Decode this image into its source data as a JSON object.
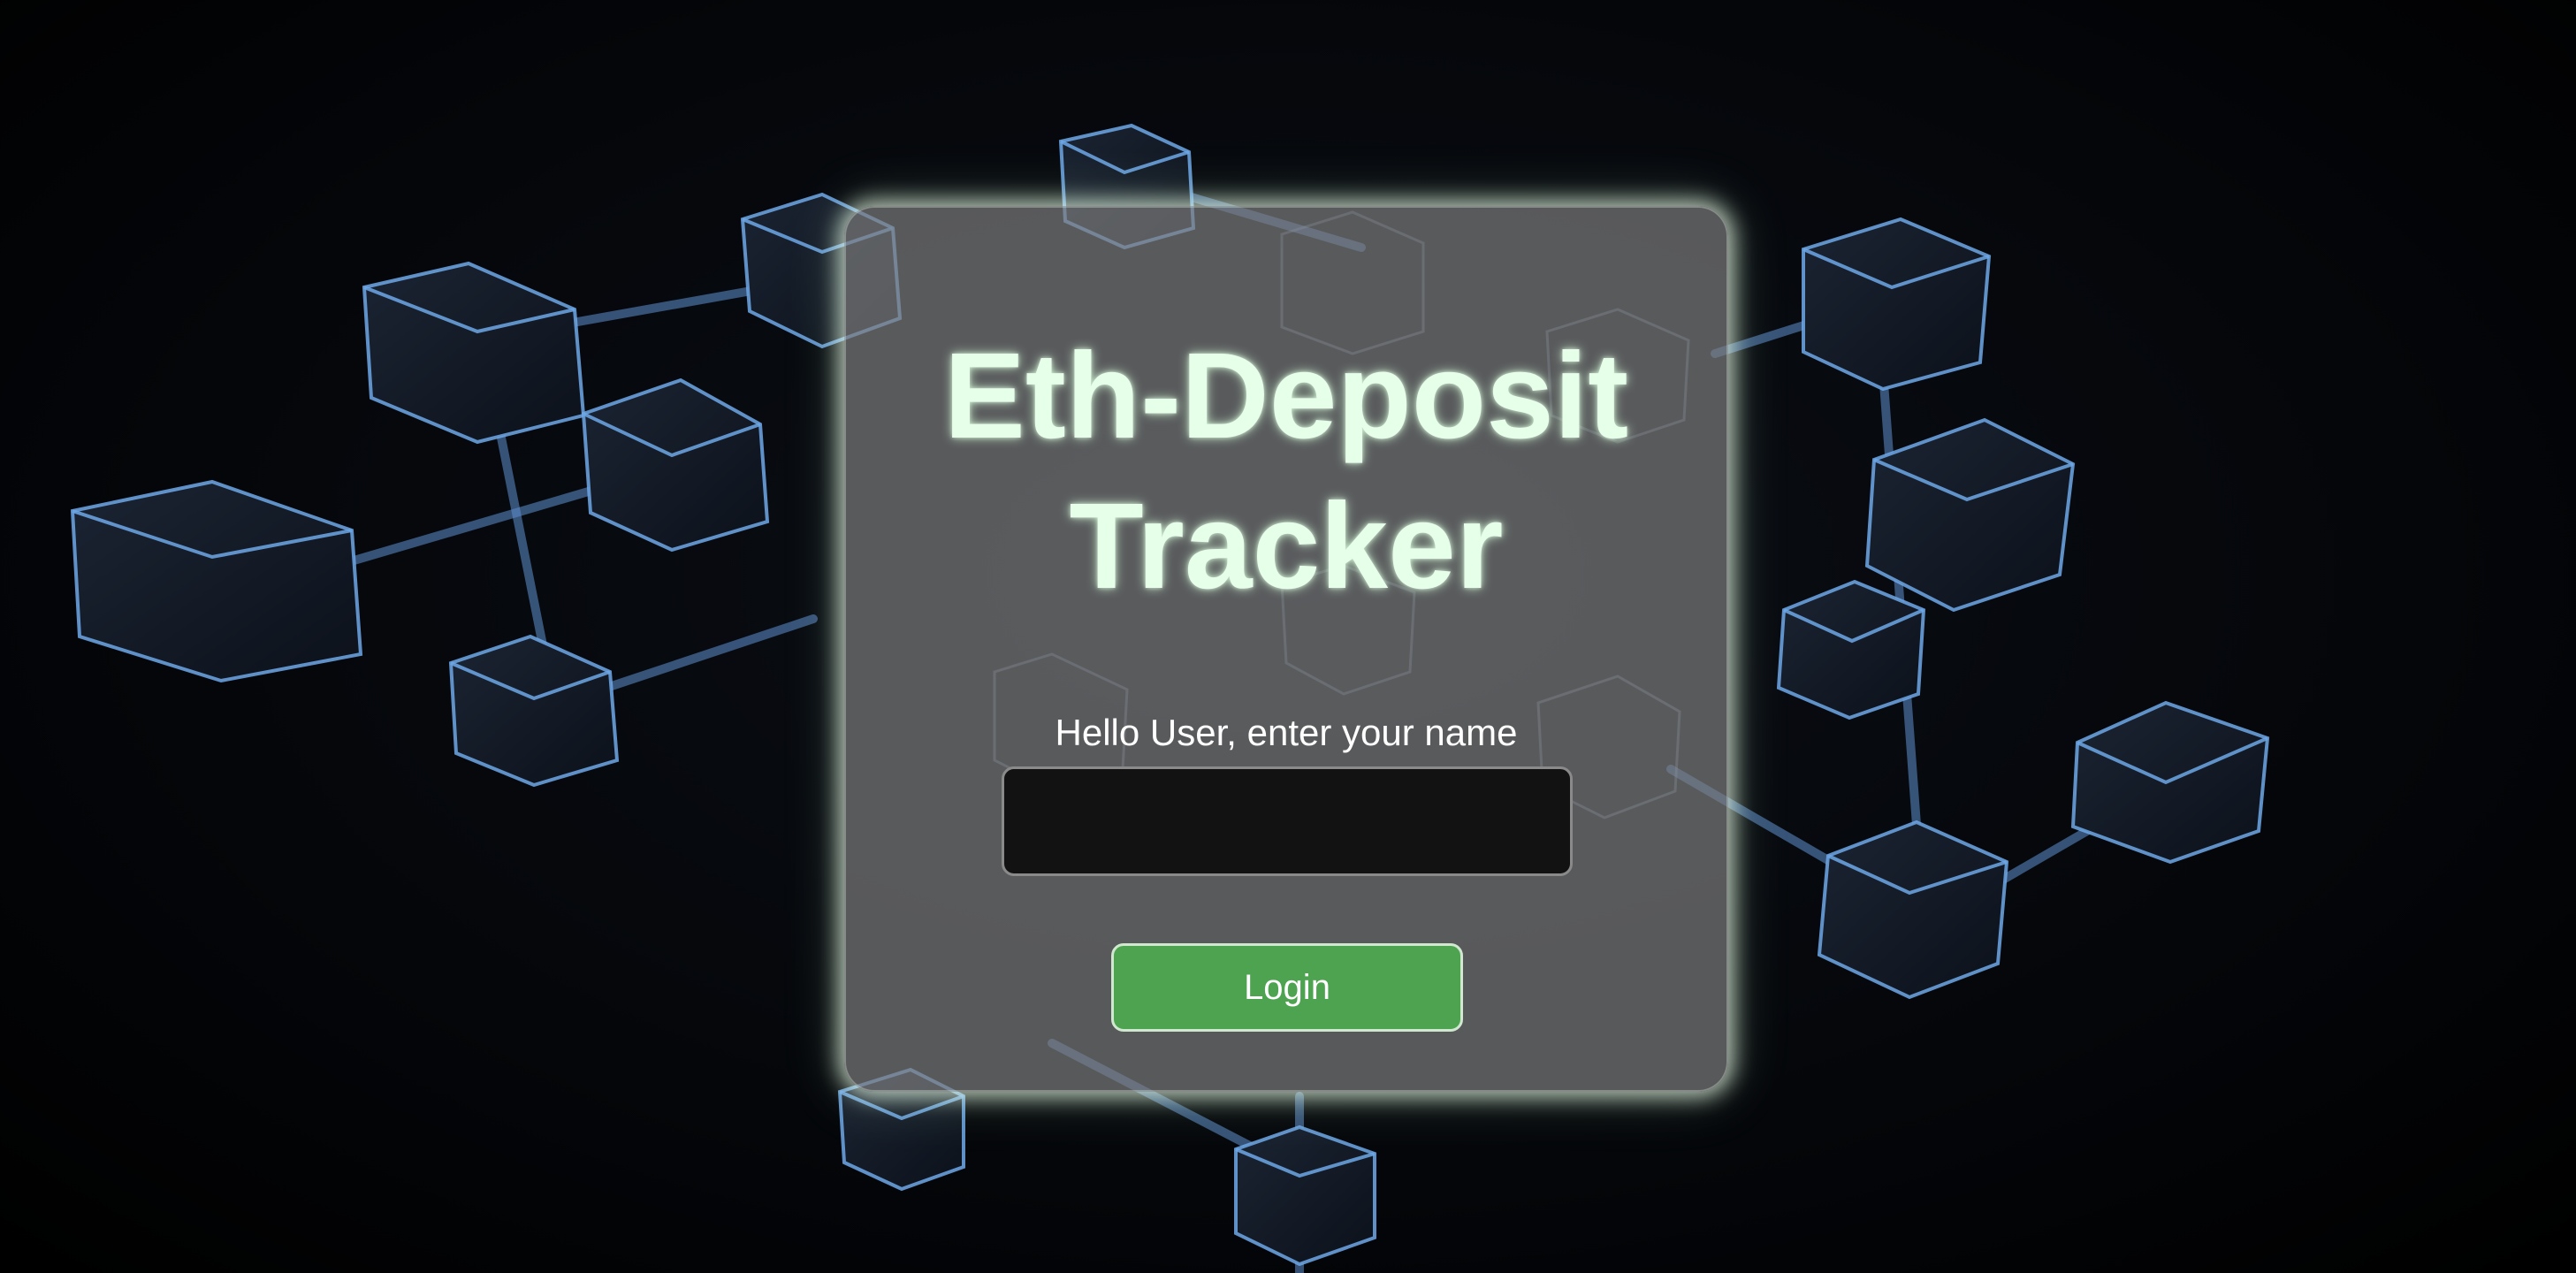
{
  "app": {
    "title": "Eth-Deposit",
    "title_line2": "Tracker"
  },
  "login": {
    "prompt": "Hello User, enter your name",
    "name_input_value": "",
    "name_input_placeholder": "",
    "login_label": "Login"
  },
  "colors": {
    "page_background": "#000000",
    "card_background": "#808080",
    "title_glow": "#e6ffe9",
    "input_background": "#121212",
    "login_button": "#4da350",
    "cube_edges": "#6fa8e8"
  }
}
